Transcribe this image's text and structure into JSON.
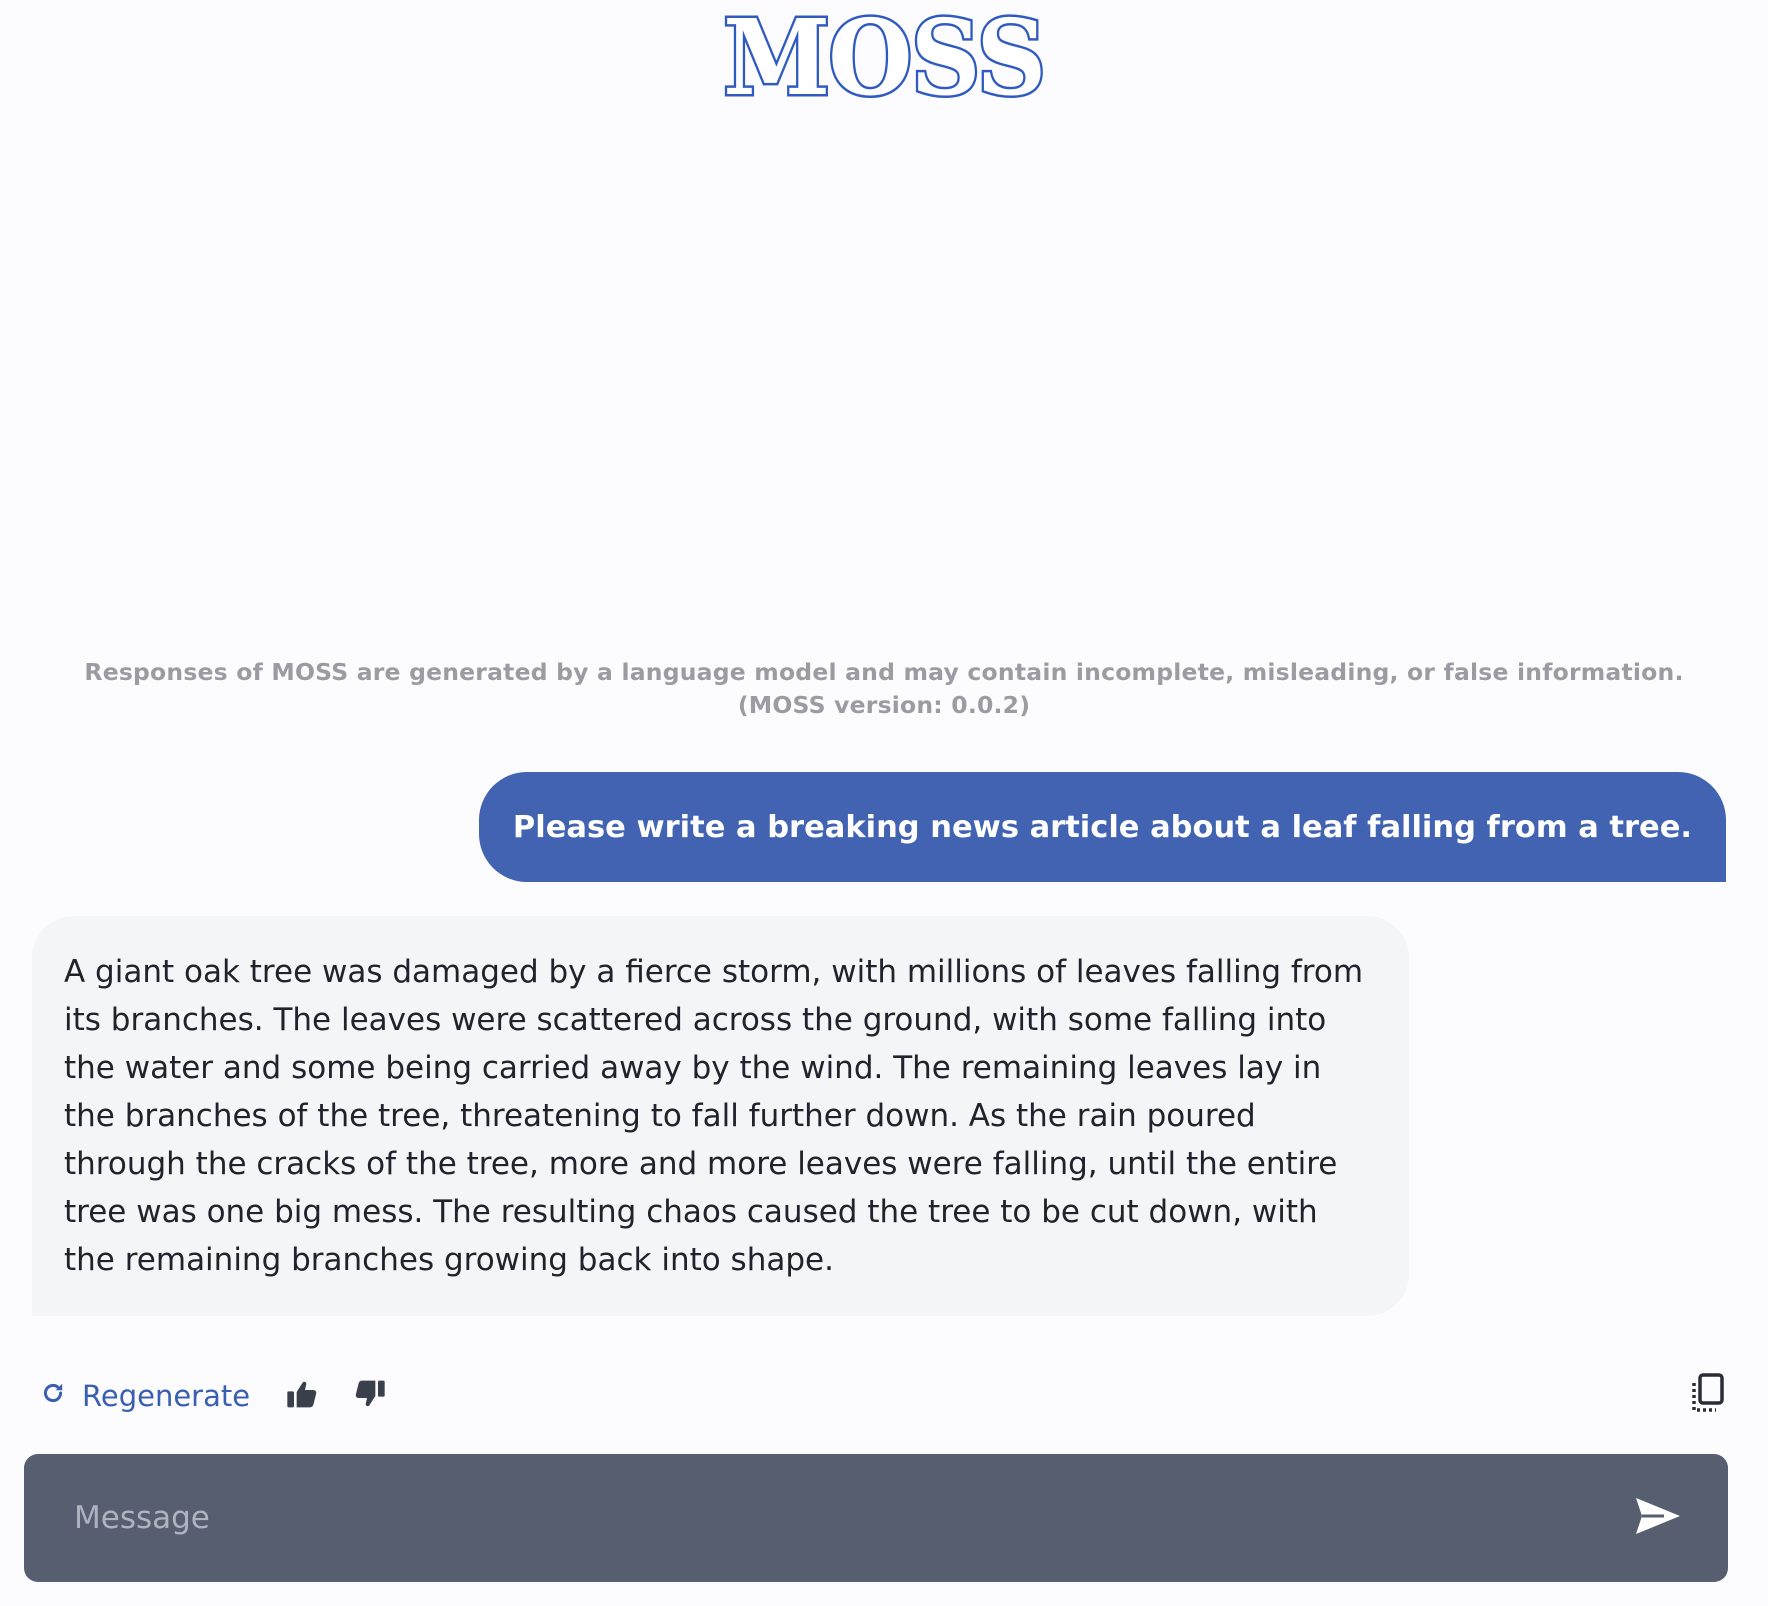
{
  "header": {
    "logo_text": "MOSS"
  },
  "disclaimer": {
    "text": "Responses of MOSS are generated by a language model and may contain incomplete, misleading, or false information. (MOSS version: 0.0.2)"
  },
  "conversation": {
    "user_message": "Please write a breaking news article about a leaf falling from a tree.",
    "assistant_message": "A giant oak tree was damaged by a fierce storm, with millions of leaves falling from its branches. The leaves were scattered across the ground, with some falling into the water and some being carried away by the wind. The remaining leaves lay in the branches of the tree, threatening to fall further down. As the rain poured through the cracks of the tree, more and more leaves were falling, until the entire tree was one big mess. The resulting chaos caused the tree to be cut down, with the remaining branches growing back into shape."
  },
  "actions": {
    "regenerate_label": "Regenerate",
    "icons": [
      "refresh-icon",
      "thumbs-up-icon",
      "thumbs-down-icon",
      "copy-icon"
    ]
  },
  "composer": {
    "placeholder": "Message",
    "value": "",
    "send_icon": "send-icon"
  },
  "colors": {
    "accent": "#4263b2",
    "logo_stroke": "#2f5bc0",
    "input_bar": "#575e70",
    "assistant_bubble": "#f4f5f6",
    "disclaimer_text": "#9c9ba3"
  }
}
